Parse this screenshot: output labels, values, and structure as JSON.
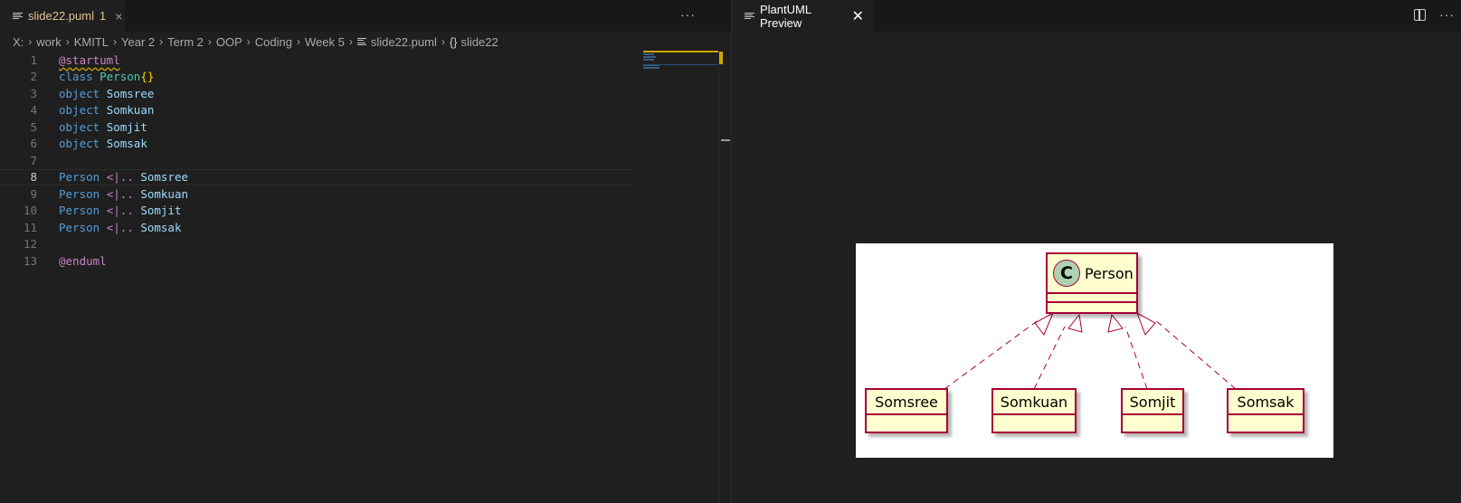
{
  "editor": {
    "tab": {
      "filename": "slide22.puml",
      "badge": "1",
      "close": "×"
    },
    "more": "···",
    "breadcrumb": [
      "X:",
      "work",
      "KMITL",
      "Year 2",
      "Term 2",
      "OOP",
      "Coding",
      "Week 5",
      "slide22.puml",
      "slide22"
    ],
    "lines": [
      {
        "n": "1",
        "tokens": [
          {
            "t": "@startuml",
            "c": "dir squiggle"
          }
        ]
      },
      {
        "n": "2",
        "tokens": [
          {
            "t": "class ",
            "c": "kw"
          },
          {
            "t": "Person",
            "c": "cls"
          },
          {
            "t": "{}",
            "c": "brace"
          }
        ]
      },
      {
        "n": "3",
        "tokens": [
          {
            "t": "object ",
            "c": "kw"
          },
          {
            "t": "Somsree",
            "c": "id"
          }
        ]
      },
      {
        "n": "4",
        "tokens": [
          {
            "t": "object ",
            "c": "kw"
          },
          {
            "t": "Somkuan",
            "c": "id"
          }
        ]
      },
      {
        "n": "5",
        "tokens": [
          {
            "t": "object ",
            "c": "kw"
          },
          {
            "t": "Somjit",
            "c": "id"
          }
        ]
      },
      {
        "n": "6",
        "tokens": [
          {
            "t": "object ",
            "c": "kw"
          },
          {
            "t": "Somsak",
            "c": "id"
          }
        ]
      },
      {
        "n": "7",
        "tokens": []
      },
      {
        "n": "8",
        "tokens": [
          {
            "t": "Person ",
            "c": "kw"
          },
          {
            "t": "<|..",
            "c": "dir"
          },
          {
            "t": " Somsree",
            "c": "id"
          }
        ]
      },
      {
        "n": "9",
        "tokens": [
          {
            "t": "Person ",
            "c": "kw"
          },
          {
            "t": "<|..",
            "c": "dir"
          },
          {
            "t": " Somkuan",
            "c": "id"
          }
        ]
      },
      {
        "n": "10",
        "tokens": [
          {
            "t": "Person ",
            "c": "kw"
          },
          {
            "t": "<|..",
            "c": "dir"
          },
          {
            "t": " Somjit",
            "c": "id"
          }
        ]
      },
      {
        "n": "11",
        "tokens": [
          {
            "t": "Person ",
            "c": "kw"
          },
          {
            "t": "<|..",
            "c": "dir"
          },
          {
            "t": " Somsak",
            "c": "id"
          }
        ]
      },
      {
        "n": "12",
        "tokens": []
      },
      {
        "n": "13",
        "tokens": [
          {
            "t": "@enduml",
            "c": "dir"
          }
        ]
      }
    ],
    "active_line": "8"
  },
  "preview": {
    "tab": {
      "title": "PlantUML Preview",
      "close": "✕"
    },
    "more": "···",
    "diagram": {
      "class_name": "Person",
      "stereotype_letter": "C",
      "objects": [
        "Somsree",
        "Somkuan",
        "Somjit",
        "Somsak"
      ]
    }
  },
  "colors": {
    "background": "#1f1f1f",
    "accent_modified": "#e2c08d",
    "uml_border": "#a80036",
    "uml_fill": "#fefece",
    "uml_class_circle": "#add1b2"
  }
}
